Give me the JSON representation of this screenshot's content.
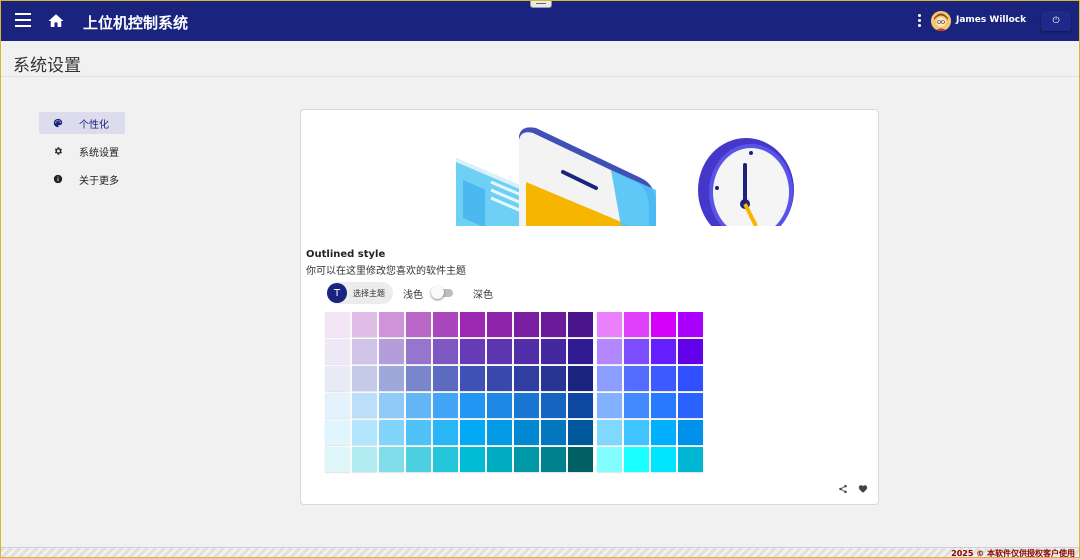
{
  "appbar": {
    "title": "上位机控制系统",
    "username": "James Willock",
    "power_symbol": "⏻"
  },
  "page": {
    "title": "系统设置"
  },
  "sidenav": {
    "items": [
      {
        "label": "个性化",
        "icon": "palette-icon",
        "active": true
      },
      {
        "label": "系统设置",
        "icon": "gear-icon",
        "active": false
      },
      {
        "label": "关于更多",
        "icon": "info-icon",
        "active": false
      }
    ]
  },
  "card": {
    "title": "Outlined style",
    "subtitle": "你可以在这里修改您喜欢的软件主题",
    "theme_badge": "T",
    "theme_button": "选择主题",
    "light_label": "浅色",
    "dark_label": "深色",
    "dark_mode": false
  },
  "palette": [
    [
      "#f3e5f5",
      "#e1bee7",
      "#ce93d8",
      "#ba68c8",
      "#ab47bc",
      "#9c27b0",
      "#8e24aa",
      "#7b1fa2",
      "#6a1b9a",
      "#4a148c",
      "#ea80fc",
      "#e040fb",
      "#d500f9",
      "#aa00ff"
    ],
    [
      "#ede7f6",
      "#d1c4e9",
      "#b39ddb",
      "#9575cd",
      "#7e57c2",
      "#673ab7",
      "#5e35b1",
      "#512da8",
      "#4527a0",
      "#311b92",
      "#b388ff",
      "#7c4dff",
      "#651fff",
      "#6200ea"
    ],
    [
      "#e8eaf6",
      "#c5cae9",
      "#9fa8da",
      "#7986cb",
      "#5c6bc0",
      "#3f51b5",
      "#3949ab",
      "#303f9f",
      "#283593",
      "#1a237e",
      "#8c9eff",
      "#536dfe",
      "#3d5afe",
      "#304ffe"
    ],
    [
      "#e3f2fd",
      "#bbdefb",
      "#90caf9",
      "#64b5f6",
      "#42a5f5",
      "#2196f3",
      "#1e88e5",
      "#1976d2",
      "#1565c0",
      "#0d47a1",
      "#82b1ff",
      "#448aff",
      "#2979ff",
      "#2962ff"
    ],
    [
      "#e1f5fe",
      "#b3e5fc",
      "#81d4fa",
      "#4fc3f7",
      "#29b6f6",
      "#03a9f4",
      "#039be5",
      "#0288d1",
      "#0277bd",
      "#01579b",
      "#80d8ff",
      "#40c4ff",
      "#00b0ff",
      "#0091ea"
    ],
    [
      "#e0f7fa",
      "#b2ebf2",
      "#80deea",
      "#4dd0e1",
      "#26c6da",
      "#00bcd4",
      "#00acc1",
      "#0097a7",
      "#00838f",
      "#006064",
      "#84ffff",
      "#18ffff",
      "#00e5ff",
      "#00b8d4"
    ]
  ],
  "footer": {
    "copyright": "2025 © 本软件仅供授权客户使用"
  },
  "colors": {
    "primary": "#1a237e",
    "background": "#f1f1f1"
  }
}
